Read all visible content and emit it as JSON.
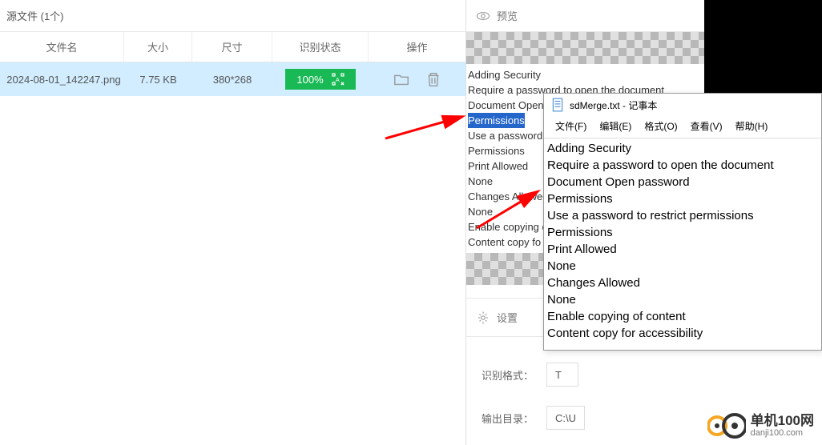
{
  "left": {
    "header": "源文件 (1个)",
    "columns": {
      "name": "文件名",
      "size": "大小",
      "dim": "尺寸",
      "status": "识别状态",
      "actions": "操作"
    },
    "rows": [
      {
        "name": "2024-08-01_142247.png",
        "size": "7.75 KB",
        "dim": "380*268",
        "status": "100%"
      }
    ]
  },
  "preview": {
    "title": "预览",
    "lines": [
      "Adding Security",
      "Require a password to open the document",
      "Document Open ",
      "Permissions",
      "Use a password ",
      "Permissions",
      "Print Allowed",
      "None",
      "Changes Allowed",
      "None",
      "Enable copying o",
      "Content copy fo"
    ]
  },
  "settings": {
    "title": "设置",
    "format_label": "识别格式：",
    "format_value": "T",
    "output_label": "输出目录：",
    "output_value": "C:\\U"
  },
  "notepad": {
    "title": "sdMerge.txt - 记事本",
    "menu": {
      "file": "文件(F)",
      "edit": "编辑(E)",
      "format": "格式(O)",
      "view": "查看(V)",
      "help": "帮助(H)"
    },
    "body": [
      "Adding Security",
      "Require a password to open the document",
      "Document Open password",
      "Permissions",
      "Use a password to restrict permissions",
      "Permissions",
      "Print Allowed",
      "None",
      "Changes Allowed",
      "None",
      "Enable copying of content",
      "Content copy for accessibility"
    ]
  },
  "logo": {
    "cn": "单机100网",
    "en": "danji100.com"
  }
}
